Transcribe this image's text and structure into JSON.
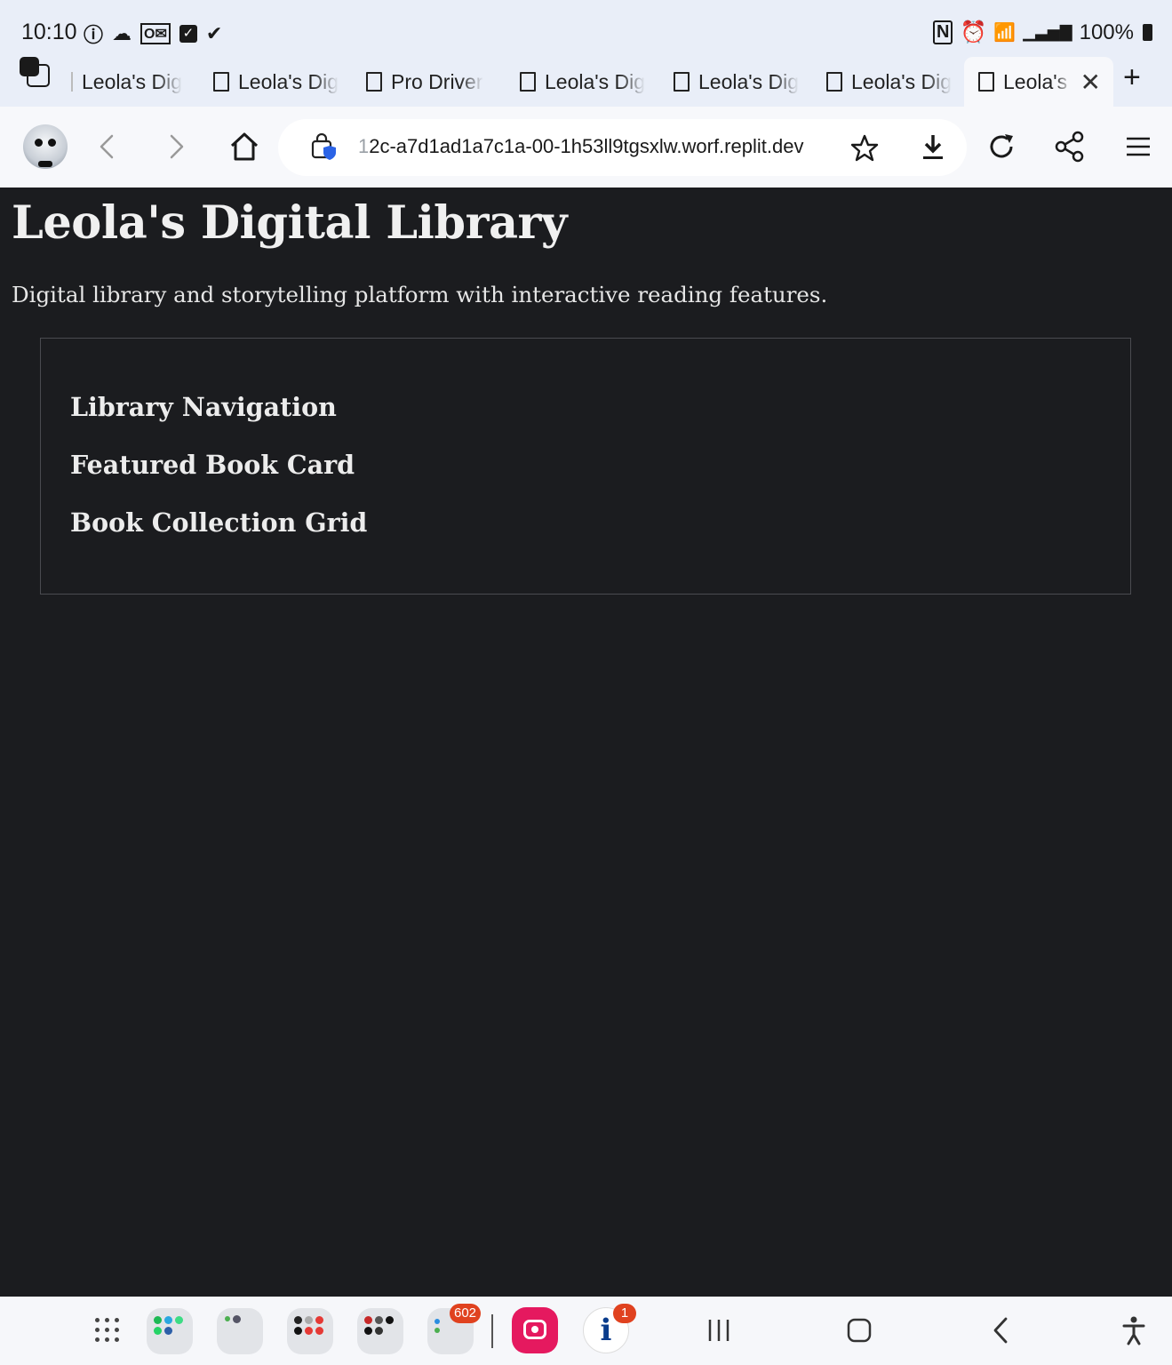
{
  "status_bar": {
    "time": "10:10",
    "battery_label": "100%",
    "left_icons": [
      "info-notification-icon",
      "cloud-icon",
      "outlook-icon",
      "checkbox-icon",
      "check-icon"
    ],
    "right_icons": [
      "nfc-icon",
      "alarm-icon",
      "wifi-icon",
      "signal-icon",
      "battery-icon"
    ]
  },
  "tabs": [
    {
      "label": "Leola's Dig",
      "active": false
    },
    {
      "label": "Leola's Dig",
      "active": false
    },
    {
      "label": "Pro Driver",
      "active": false
    },
    {
      "label": "Leola's Dig",
      "active": false
    },
    {
      "label": "Leola's Dig",
      "active": false
    },
    {
      "label": "Leola's Dig",
      "active": false
    },
    {
      "label": "Leola's I",
      "active": true
    }
  ],
  "toolbar": {
    "url_prefix": "1",
    "url": "2c-a7d1ad1a7c1a-00-1h53ll9tgsxlw.worf.replit.dev"
  },
  "page": {
    "title": "Leola's Digital Library",
    "description": "Digital library and storytelling platform with interactive reading features.",
    "sections": [
      "Library Navigation",
      "Featured Book Card",
      "Book Collection Grid"
    ]
  },
  "dock": {
    "badge_602": "602",
    "badge_1": "1",
    "info_app_glyph": "i"
  },
  "colors": {
    "page_background": "#1b1c1f",
    "chrome_background": "#e9eef8",
    "toolbar_background": "#f7f8fb",
    "camera_app": "#e5195f",
    "badge": "#e0421f"
  }
}
